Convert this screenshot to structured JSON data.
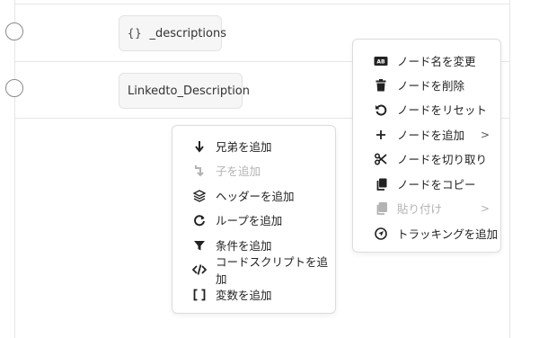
{
  "nodes": [
    {
      "icon": "{}",
      "label": "_descriptions"
    },
    {
      "icon": "",
      "label": "Linkedto_Description"
    }
  ],
  "context_menu_left": {
    "items": [
      {
        "label": "兄弟を追加",
        "icon": "arrow-down-icon",
        "disabled": false
      },
      {
        "label": "子を追加",
        "icon": "subdirectory-arrow-icon",
        "disabled": true
      },
      {
        "label": "ヘッダーを追加",
        "icon": "layers-icon",
        "disabled": false
      },
      {
        "label": "ループを追加",
        "icon": "loop-icon",
        "disabled": false
      },
      {
        "label": "条件を追加",
        "icon": "filter-icon",
        "disabled": false
      },
      {
        "label": "コードスクリプトを追加",
        "icon": "code-icon",
        "disabled": false
      },
      {
        "label": "変数を追加",
        "icon": "brackets-icon",
        "disabled": false
      }
    ]
  },
  "context_menu_right": {
    "items": [
      {
        "label": "ノード名を変更",
        "icon": "rename-icon",
        "disabled": false
      },
      {
        "label": "ノードを削除",
        "icon": "trash-icon",
        "disabled": false
      },
      {
        "label": "ノードをリセット",
        "icon": "reset-icon",
        "disabled": false
      },
      {
        "label": "ノードを追加",
        "icon": "plus-icon",
        "disabled": false,
        "submenu": ">"
      },
      {
        "label": "ノードを切り取り",
        "icon": "scissors-icon",
        "disabled": false
      },
      {
        "label": "ノードをコピー",
        "icon": "copy-icon",
        "disabled": false
      },
      {
        "label": "貼り付け",
        "icon": "paste-icon",
        "disabled": true,
        "submenu": ">"
      },
      {
        "label": "トラッキングを追加",
        "icon": "tracking-icon",
        "disabled": false
      }
    ]
  }
}
